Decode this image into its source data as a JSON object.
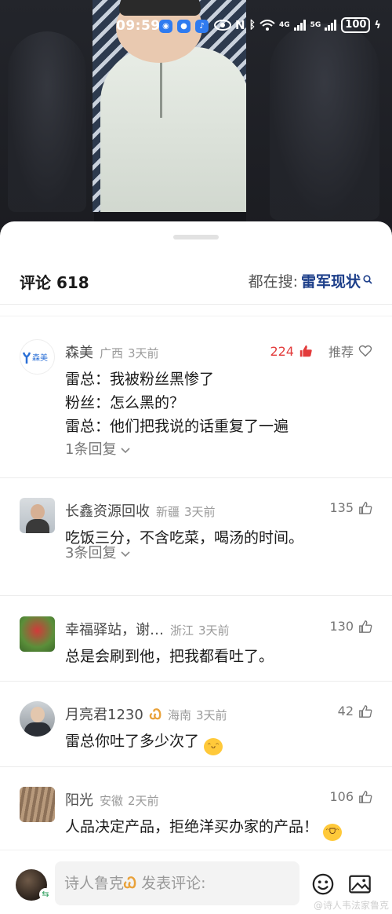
{
  "status_bar": {
    "time": "09:59",
    "network_4g": "4G",
    "network_5g": "5G",
    "battery": "100"
  },
  "header": {
    "title": "评论 618",
    "search_prefix": "都在搜:",
    "search_keyword": "雷军现状"
  },
  "comments": [
    {
      "name": "森美",
      "location": "广西",
      "time": "3天前",
      "likes": "224",
      "recommend_label": "推荐",
      "lines": [
        "雷总：我被粉丝黑惨了",
        "粉丝：怎么黑的？",
        "雷总：他们把我说的话重复了一遍"
      ],
      "replies": "1条回复"
    },
    {
      "name": "长鑫资源回收",
      "location": "新疆",
      "time": "3天前",
      "likes": "135",
      "lines": [
        "吃饭三分，不含吃菜，喝汤的时间。"
      ],
      "replies": "3条回复"
    },
    {
      "name": "幸福驿站，谢…",
      "location": "浙江",
      "time": "3天前",
      "likes": "130",
      "lines": [
        "总是会刷到他，把我都看吐了。"
      ]
    },
    {
      "name": "月亮君1230",
      "location": "海南",
      "time": "3天前",
      "likes": "42",
      "lines": [
        "雷总你吐了多少次了"
      ]
    },
    {
      "name": "阳光",
      "location": "安徽",
      "time": "2天前",
      "likes": "106",
      "lines": [
        "人品决定产品，拒绝洋买办家的产品！"
      ]
    }
  ],
  "input_bar": {
    "user": "诗人鲁克",
    "placeholder": "发表评论:"
  },
  "watermark": "@诗人韦法家鲁克",
  "colors": {
    "hot_likes": "#e33b3b",
    "vip_badge": "#e9a23b",
    "search_keyword": "#1d3f8a"
  },
  "icons": [
    "thumbs-up-icon",
    "heart-icon",
    "chevron-down-icon",
    "search-icon",
    "emoji-icon",
    "image-icon"
  ]
}
